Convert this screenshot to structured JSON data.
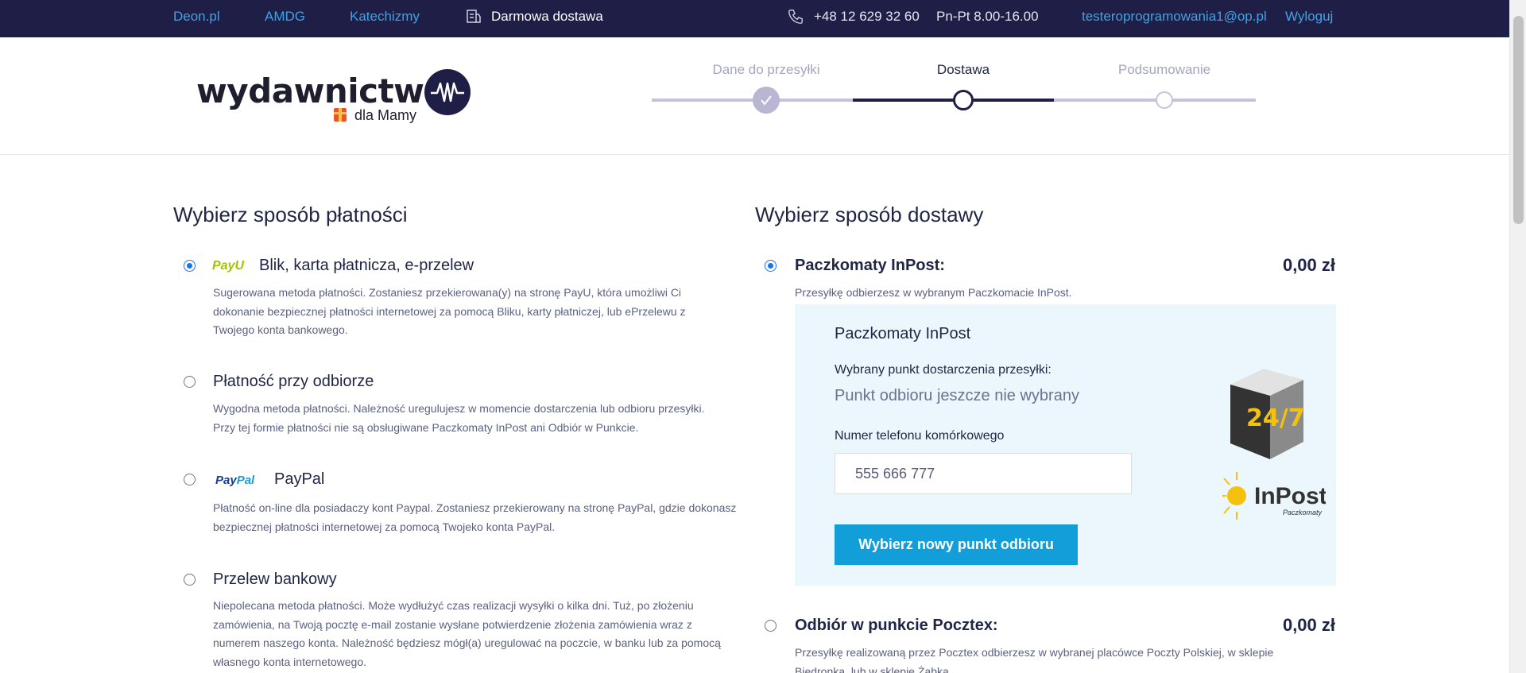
{
  "topbar": {
    "links": [
      "Deon.pl",
      "AMDG",
      "Katechizmy"
    ],
    "delivery_label": "Darmowa dostawa",
    "phone": "+48 12 629 32 60",
    "hours": "Pn-Pt 8.00-16.00",
    "email": "testeroprogramowania1@op.pl",
    "logout": "Wyloguj"
  },
  "header": {
    "logo_word": "wydawnictwo",
    "logo_sub": "dla Mamy",
    "steps": [
      {
        "label": "Dane do przesyłki",
        "state": "done"
      },
      {
        "label": "Dostawa",
        "state": "active"
      },
      {
        "label": "Podsumowanie",
        "state": "pending"
      }
    ]
  },
  "payment": {
    "title": "Wybierz sposób płatności",
    "options": [
      {
        "brand": "PayU",
        "title": "Blik, karta płatnicza, e-przelew",
        "selected": true,
        "lines": [
          "Sugerowana metoda płatności. Zostaniesz przekierowana(y) na stronę PayU, która umożliwi Ci",
          "dokonanie bezpiecznej płatności internetowej za pomocą Bliku, karty płatniczej, lub ePrzelewu z",
          "Twojego konta bankowego."
        ]
      },
      {
        "brand": "",
        "title": "Płatność przy odbiorze",
        "selected": false,
        "lines": [
          "Wygodna metoda płatności. Należność uregulujesz w momencie dostarczenia lub odbioru przesyłki.",
          "Przy tej formie płatności nie są obsługiwane Paczkomaty InPost ani Odbiór w Punkcie."
        ]
      },
      {
        "brand": "PayPal",
        "title": "PayPal",
        "selected": false,
        "lines": [
          "Płatność on-line dla posiadaczy kont Paypal. Zostaniesz przekierowany na stronę PayPal, gdzie dokonasz",
          "bezpiecznej płatności internetowej za pomocą Twojeko konta PayPal."
        ]
      },
      {
        "brand": "",
        "title": "Przelew bankowy",
        "selected": false,
        "lines": [
          "Niepolecana metoda płatności. Może wydłużyć czas realizacji wysyłki o kilka dni. Tuż, po złożeniu",
          "zamówienia, na Twoją pocztę e-mail zostanie wysłane potwierdzenie złożenia zamówienia wraz z",
          "numerem naszego konta. Należność będziesz mógł(a) uregulować na poczcie, w banku lub za pomocą",
          "własnego konta internetowego."
        ]
      }
    ]
  },
  "delivery": {
    "title": "Wybierz sposób dostawy",
    "options": [
      {
        "title": "Paczkomaty InPost:",
        "price": "0,00 zł",
        "selected": true,
        "desc": "Przesyłkę odbierzesz w wybranym Paczkomacie InPost."
      },
      {
        "title": "Odbiór w punkcie Pocztex:",
        "price": "0,00 zł",
        "selected": false,
        "desc": "Przesyłkę realizowaną przez Pocztex odbierzesz w wybranej placówce Poczty Polskiej, w sklepie",
        "desc2": "Biedronka, lub w sklepie Żabka."
      }
    ],
    "panel": {
      "title": "Paczkomaty InPost",
      "point_label": "Wybrany punkt dostarczenia przesyłki:",
      "point_value": "Punkt odbioru jeszcze nie wybrany",
      "phone_label": "Numer telefonu komórkowego",
      "phone_placeholder": "555 666 777",
      "button": "Wybierz nowy punkt odbioru",
      "logo_text": "InPost",
      "logo_sub": "Paczkomaty",
      "badge_text": "24/7"
    }
  },
  "colors": {
    "topbar_bg": "#1f1e46",
    "link": "#3fa3e6",
    "accent_button": "#129ed9",
    "panel_bg": "#ecf6fd",
    "step_active": "#1f1e46",
    "step_inactive": "#c5c3dc"
  }
}
